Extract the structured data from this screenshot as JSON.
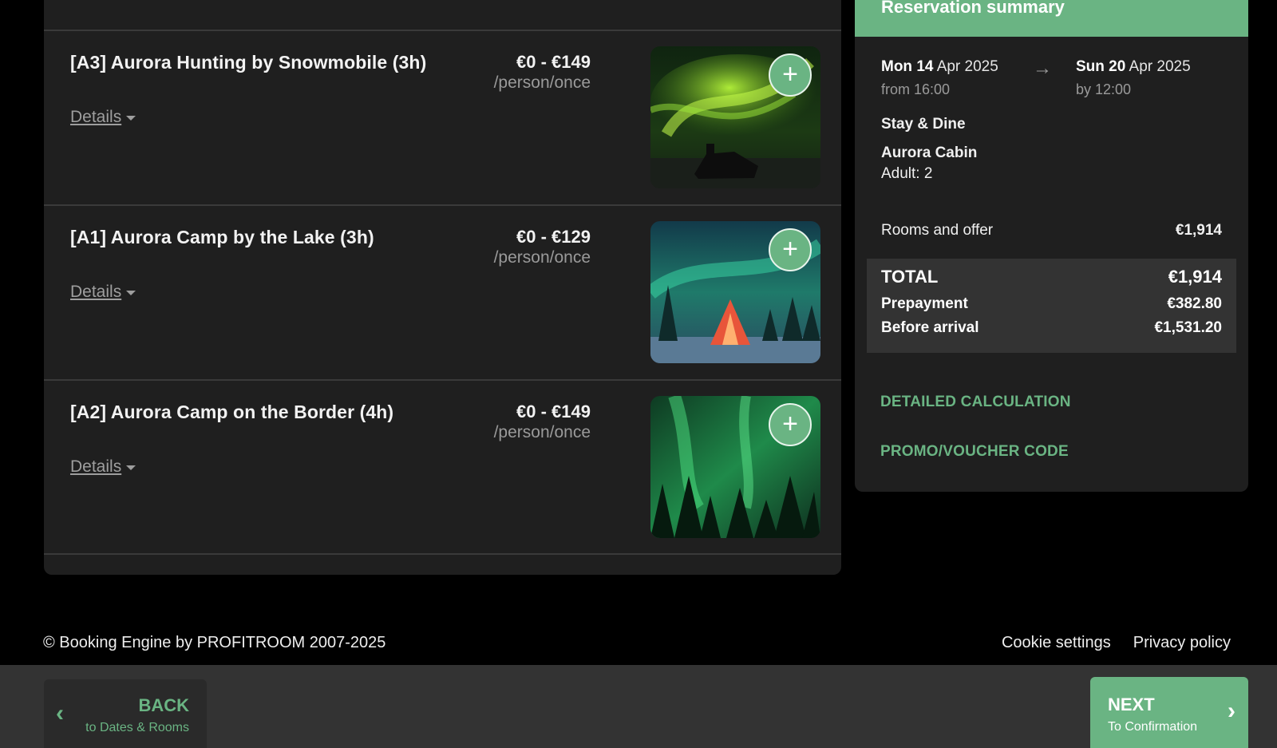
{
  "offers": [
    {
      "title": "[A3] Aurora Hunting by Snowmobile (3h)",
      "price_range": "€0 - €149",
      "price_unit": "/person/once",
      "details_label": "Details",
      "image_theme": "aurora-snowmobile"
    },
    {
      "title": "[A1] Aurora Camp by the Lake (3h)",
      "price_range": "€0 - €129",
      "price_unit": "/person/once",
      "details_label": "Details",
      "image_theme": "aurora-tipi"
    },
    {
      "title": "[A2] Aurora Camp on the Border (4h)",
      "price_range": "€0 - €149",
      "price_unit": "/person/once",
      "details_label": "Details",
      "image_theme": "aurora-forest"
    }
  ],
  "summary": {
    "header": "Reservation summary",
    "checkin": {
      "day": "Mon 14",
      "month_year": "Apr 2025",
      "time": "from 16:00"
    },
    "checkout": {
      "day": "Sun 20",
      "month_year": "Apr 2025",
      "time": "by 12:00"
    },
    "arrow": "→",
    "package": "Stay & Dine",
    "room": "Aurora Cabin",
    "guests": "Adult: 2",
    "rooms_label": "Rooms and offer",
    "rooms_value": "€1,914",
    "total_label": "TOTAL",
    "total_value": "€1,914",
    "prepayment_label": "Prepayment",
    "prepayment_value": "€382.80",
    "before_arrival_label": "Before arrival",
    "before_arrival_value": "€1,531.20",
    "detailed_calculation": "DETAILED CALCULATION",
    "promo_code": "PROMO/VOUCHER CODE"
  },
  "footer": {
    "copyright": "© Booking Engine by PROFITROOM 2007-2025",
    "cookie_settings": "Cookie settings",
    "privacy_policy": "Privacy policy"
  },
  "nav": {
    "back_label": "BACK",
    "back_sub": "to Dates & Rooms",
    "next_label": "NEXT",
    "next_sub": "To Confirmation"
  },
  "colors": {
    "accent": "#6ab483",
    "panel": "#1f1f1f",
    "background": "#000000",
    "navbar": "#333333"
  },
  "icons": {
    "add": "plus-icon",
    "details": "caret-down-icon",
    "back": "chevron-left-icon",
    "next": "chevron-right-icon",
    "dates": "arrow-right-icon"
  }
}
